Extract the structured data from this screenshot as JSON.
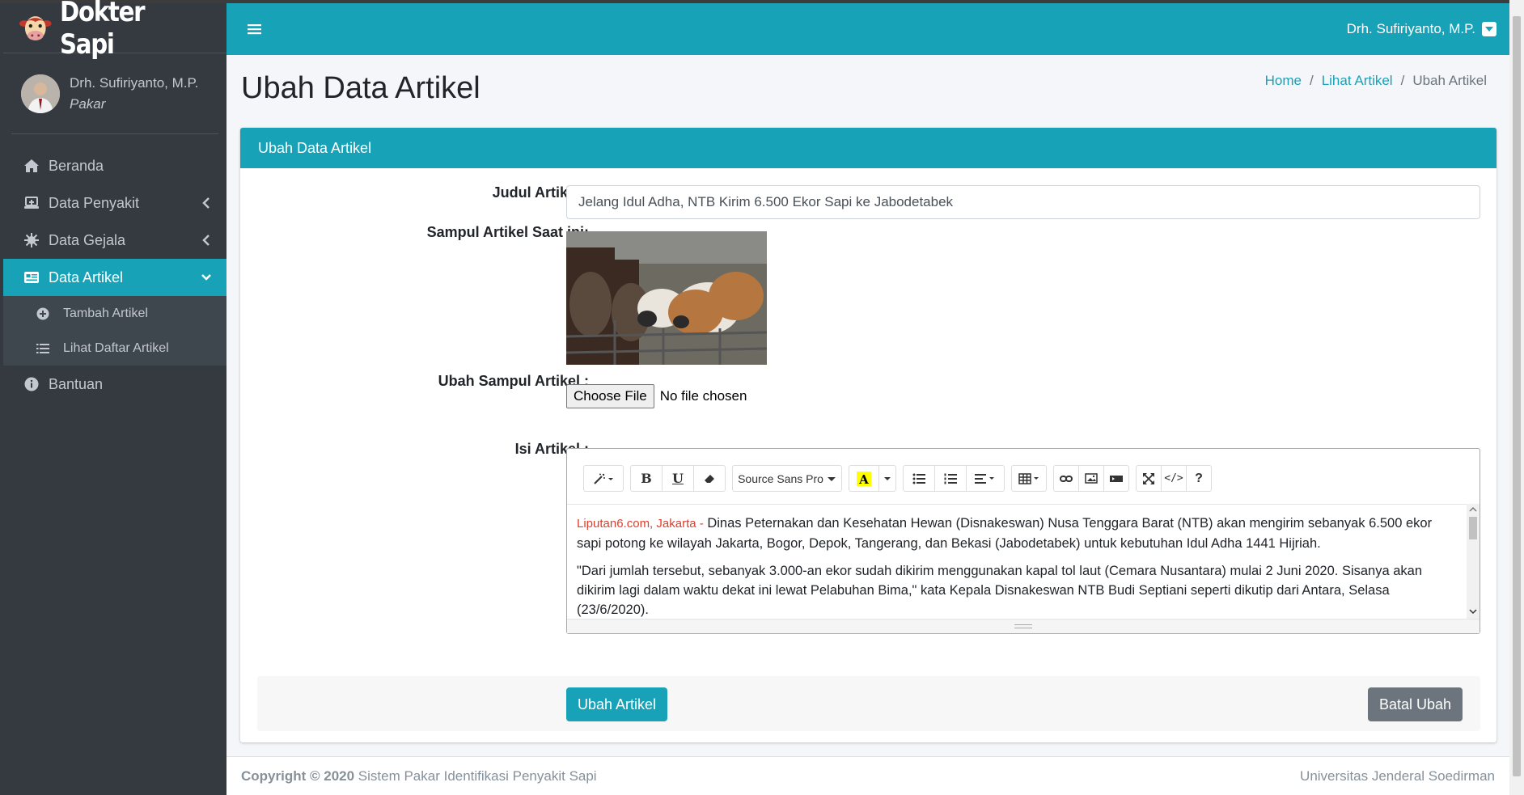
{
  "brand": {
    "name": "Dokter Sapi",
    "logo": "cow-icon"
  },
  "user_panel": {
    "name": "Drh. Sufiriyanto, M.P.",
    "role": "Pakar"
  },
  "sidebar": {
    "items": [
      {
        "label": "Beranda",
        "icon": "home-icon"
      },
      {
        "label": "Data Penyakit",
        "icon": "laptop-medical-icon"
      },
      {
        "label": "Data Gejala",
        "icon": "virus-icon"
      },
      {
        "label": "Data Artikel",
        "icon": "newspaper-icon",
        "active": true
      },
      {
        "label": "Bantuan",
        "icon": "info-circle-icon"
      }
    ],
    "subitems": [
      {
        "label": "Tambah Artikel",
        "icon": "plus-circle-icon"
      },
      {
        "label": "Lihat Daftar Artikel",
        "icon": "list-icon"
      }
    ]
  },
  "topbar": {
    "user_label": "Drh. Sufiriyanto, M.P."
  },
  "page": {
    "title": "Ubah Data Artikel",
    "breadcrumb": [
      "Home",
      "Lihat Artikel",
      "Ubah Artikel"
    ]
  },
  "form": {
    "header": "Ubah Data Artikel",
    "title_label": "Judul Artikel :",
    "title_value": "Jelang Idul Adha, NTB Kirim 6.500 Ekor Sapi ke Jabodetabek",
    "cover_label": "Sampul Artikel Saat ini:",
    "change_cover_label": "Ubah Sampul Artikel :",
    "file_button": "Choose File",
    "file_status": "No file chosen",
    "content_label": "Isi Artikel :",
    "font_name": "Source Sans Pro",
    "content": {
      "source": "Liputan6.com, Jakarta -",
      "para1": " Dinas Peternakan dan Kesehatan Hewan (Disnakeswan) Nusa Tenggara Barat (NTB) akan mengirim sebanyak 6.500 ekor sapi potong ke wilayah Jakarta, Bogor, Depok, Tangerang, dan Bekasi (Jabodetabek) untuk kebutuhan Idul Adha 1441 Hijriah.",
      "para2": "\"Dari jumlah tersebut, sebanyak 3.000-an ekor sudah dikirim menggunakan kapal tol laut (Cemara Nusantara) mulai 2 Juni 2020. Sisanya akan dikirim lagi dalam waktu dekat ini lewat Pelabuhan Bima,\" kata Kepala Disnakeswan NTB Budi Septiani seperti dikutip dari Antara, Selasa (23/6/2020)."
    },
    "submit": "Ubah Artikel",
    "cancel": "Batal Ubah"
  },
  "footer": {
    "copyright": "Copyright © 2020",
    "system": " Sistem Pakar Identifikasi Penyakit Sapi",
    "institution": "Universitas Jenderal Soedirman"
  },
  "colors": {
    "accent": "#17a2b8",
    "sidebar": "#343a40",
    "secondary": "#6c757d",
    "source_text": "#e03e2d"
  }
}
